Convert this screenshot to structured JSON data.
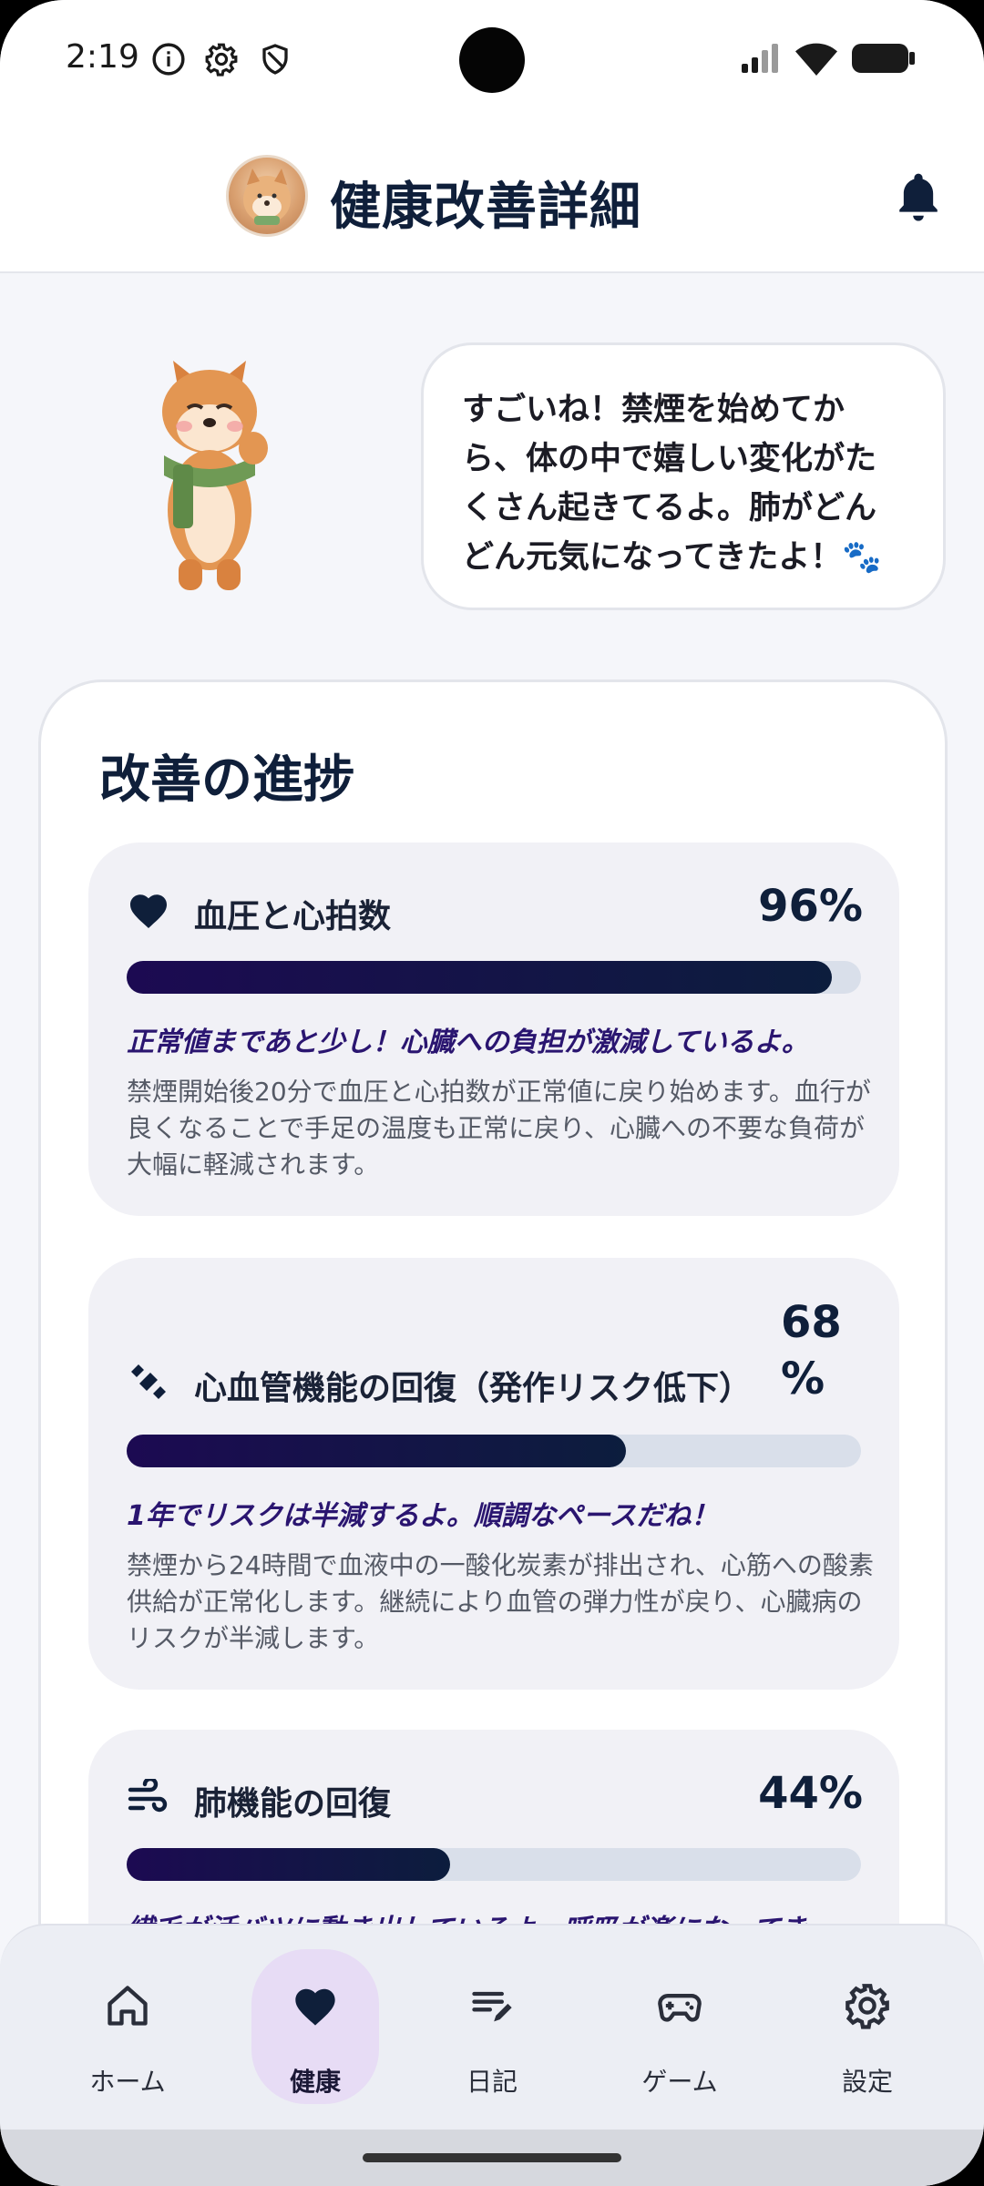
{
  "status_bar": {
    "time": "2:19",
    "icons": [
      "info-icon",
      "gear-icon",
      "shield-icon",
      "signal-icon",
      "wifi-icon",
      "battery-icon"
    ]
  },
  "header": {
    "title": "健康改善詳細",
    "avatar": "shiba-avatar",
    "bell_icon": "bell-icon"
  },
  "mascot": {
    "speech": "すごいね！禁煙を始めてから、体の中で嬉しい変化がたくさん起きてるよ。肺がどんどん元気になってきたよ！🐾"
  },
  "progress": {
    "title": "改善の進捗",
    "items": [
      {
        "icon": "heart-icon",
        "label": "血圧と心拍数",
        "percent_label": "96%",
        "percent": 96,
        "note": "正常値まであと少し！心臓への負担が激減しているよ。",
        "description": "禁煙開始後20分で血圧と心拍数が正常値に戻り始めます。血行が良くなることで手足の温度も正常に戻り、心臓への不要な負荷が大幅に軽減されます。"
      },
      {
        "icon": "dumbbell-icon",
        "label": "心血管機能の回復（発作リスク低下）",
        "percent_label": "68\n%",
        "percent": 68,
        "note": "1年でリスクは半減するよ。順調なペースだね！",
        "description": "禁煙から24時間で血液中の一酸化炭素が排出され、心筋への酸素供給が正常化します。継続により血管の弾力性が戻り、心臓病のリスクが半減します。"
      },
      {
        "icon": "wind-icon",
        "label": "肺機能の回復",
        "percent_label": "44%",
        "percent": 44,
        "note": "繊毛が活バツに動き出しているよ。呼吸が楽になってき",
        "description": ""
      }
    ]
  },
  "bottom_nav": {
    "items": [
      {
        "label": "ホーム",
        "icon": "home-icon",
        "active": false
      },
      {
        "label": "健康",
        "icon": "heart-icon",
        "active": true
      },
      {
        "label": "日記",
        "icon": "edit-note-icon",
        "active": false
      },
      {
        "label": "ゲーム",
        "icon": "gamepad-icon",
        "active": false
      },
      {
        "label": "設定",
        "icon": "settings-icon",
        "active": false
      }
    ]
  },
  "colors": {
    "accent": "#1c0a52",
    "navy": "#0f1f3a",
    "active_nav": "#e7dcf5"
  }
}
